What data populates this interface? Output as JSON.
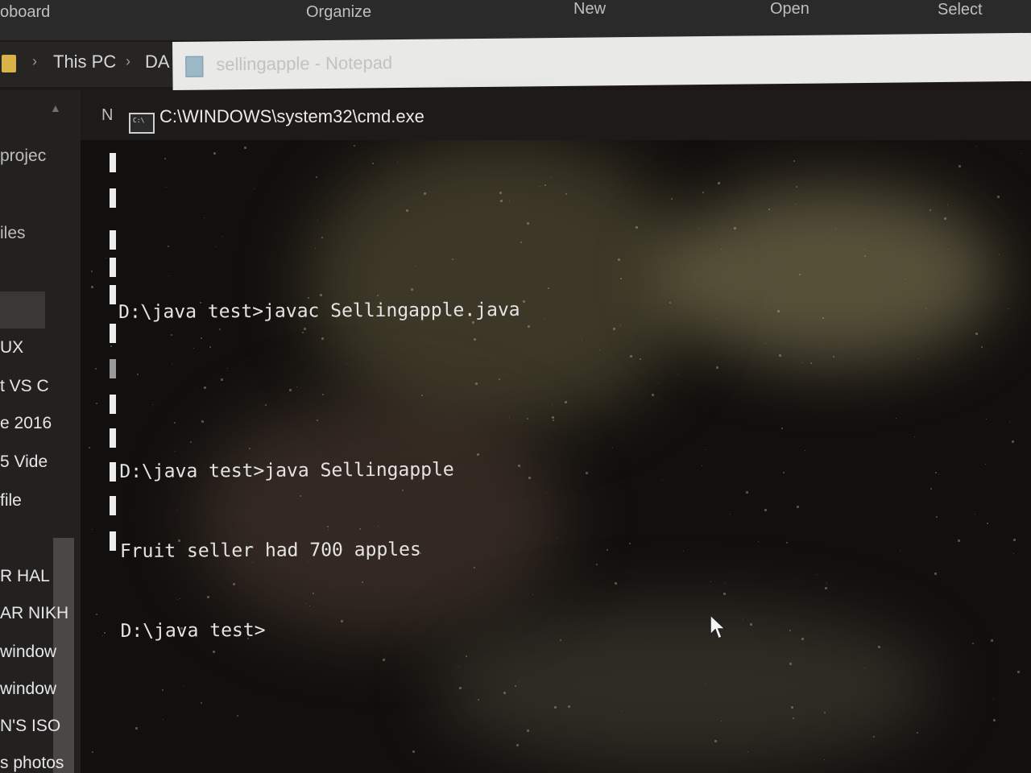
{
  "ribbon": {
    "items": [
      "oboard",
      "Organize",
      "New",
      "Open",
      "Select"
    ]
  },
  "address": {
    "crumbs": [
      "This PC",
      "DA"
    ]
  },
  "notepad": {
    "title": "sellingapple - Notepad"
  },
  "nav": {
    "items": [
      "projec",
      "iles",
      "UX",
      "t VS C",
      "e 2016",
      "5 Vide",
      "file",
      "R HAL",
      "AR NIKH",
      "window",
      "window",
      "N'S ISO",
      "s photos"
    ]
  },
  "cmd": {
    "left_label": "N",
    "title": "C:\\WINDOWS\\system32\\cmd.exe",
    "icon_text": "C:\\",
    "lines": [
      "",
      "D:\\java test>javac Sellingapple.java",
      "",
      "D:\\java test>java Sellingapple",
      "Fruit seller had 700 apples",
      "D:\\java test>"
    ]
  },
  "colors": {
    "console_bg": "#12100e",
    "console_text": "#e4e4e4",
    "folder_icon": "#d9b24a"
  }
}
